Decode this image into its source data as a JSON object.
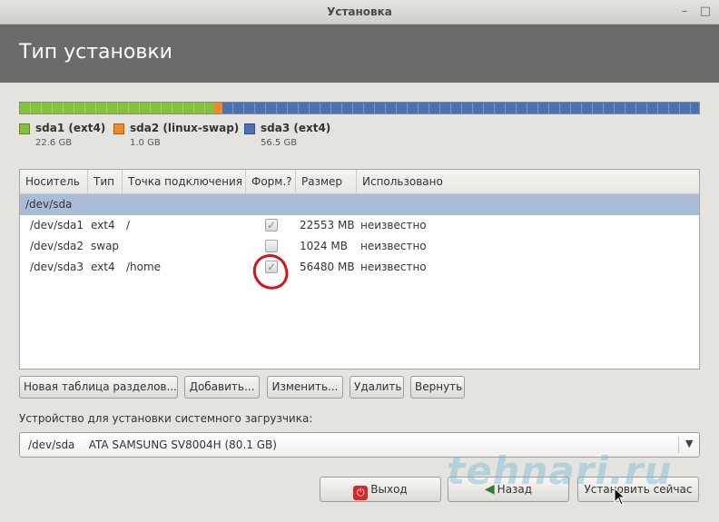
{
  "window": {
    "title": "Установка"
  },
  "header": {
    "title": "Тип установки"
  },
  "partition_bar": {
    "segments": [
      {
        "name": "sda1 (ext4)",
        "size": "22.6 GB",
        "color": "#85c13a"
      },
      {
        "name": "sda2 (linux-swap)",
        "size": "1.0 GB",
        "color": "#f08a24"
      },
      {
        "name": "sda3 (ext4)",
        "size": "56.5 GB",
        "color": "#4a72b5"
      }
    ]
  },
  "table": {
    "columns": [
      "Носитель",
      "Тип",
      "Точка подключения",
      "Форм.?",
      "Размер",
      "Использовано"
    ],
    "group": "/dev/sda",
    "rows": [
      {
        "device": "/dev/sda1",
        "type": "ext4",
        "mount": "/",
        "format": true,
        "size": "22553 MB",
        "used": "неизвестно"
      },
      {
        "device": "/dev/sda2",
        "type": "swap",
        "mount": "",
        "format": false,
        "size": "1024 MB",
        "used": "неизвестно"
      },
      {
        "device": "/dev/sda3",
        "type": "ext4",
        "mount": "/home",
        "format": true,
        "size": "56480 MB",
        "used": "неизвестно"
      }
    ]
  },
  "actions": {
    "new_table": "Новая таблица разделов...",
    "add": "Добавить...",
    "edit": "Изменить...",
    "delete": "Удалить",
    "revert": "Вернуть"
  },
  "bootloader": {
    "label": "Устройство для установки системного загрузчика:",
    "device": "/dev/sda",
    "description": "ATA SAMSUNG SV8004H (80.1 GB)"
  },
  "footer": {
    "quit": "Выход",
    "back": "Назад",
    "install": "Установить сейчас"
  },
  "watermark": "tehnari.ru"
}
